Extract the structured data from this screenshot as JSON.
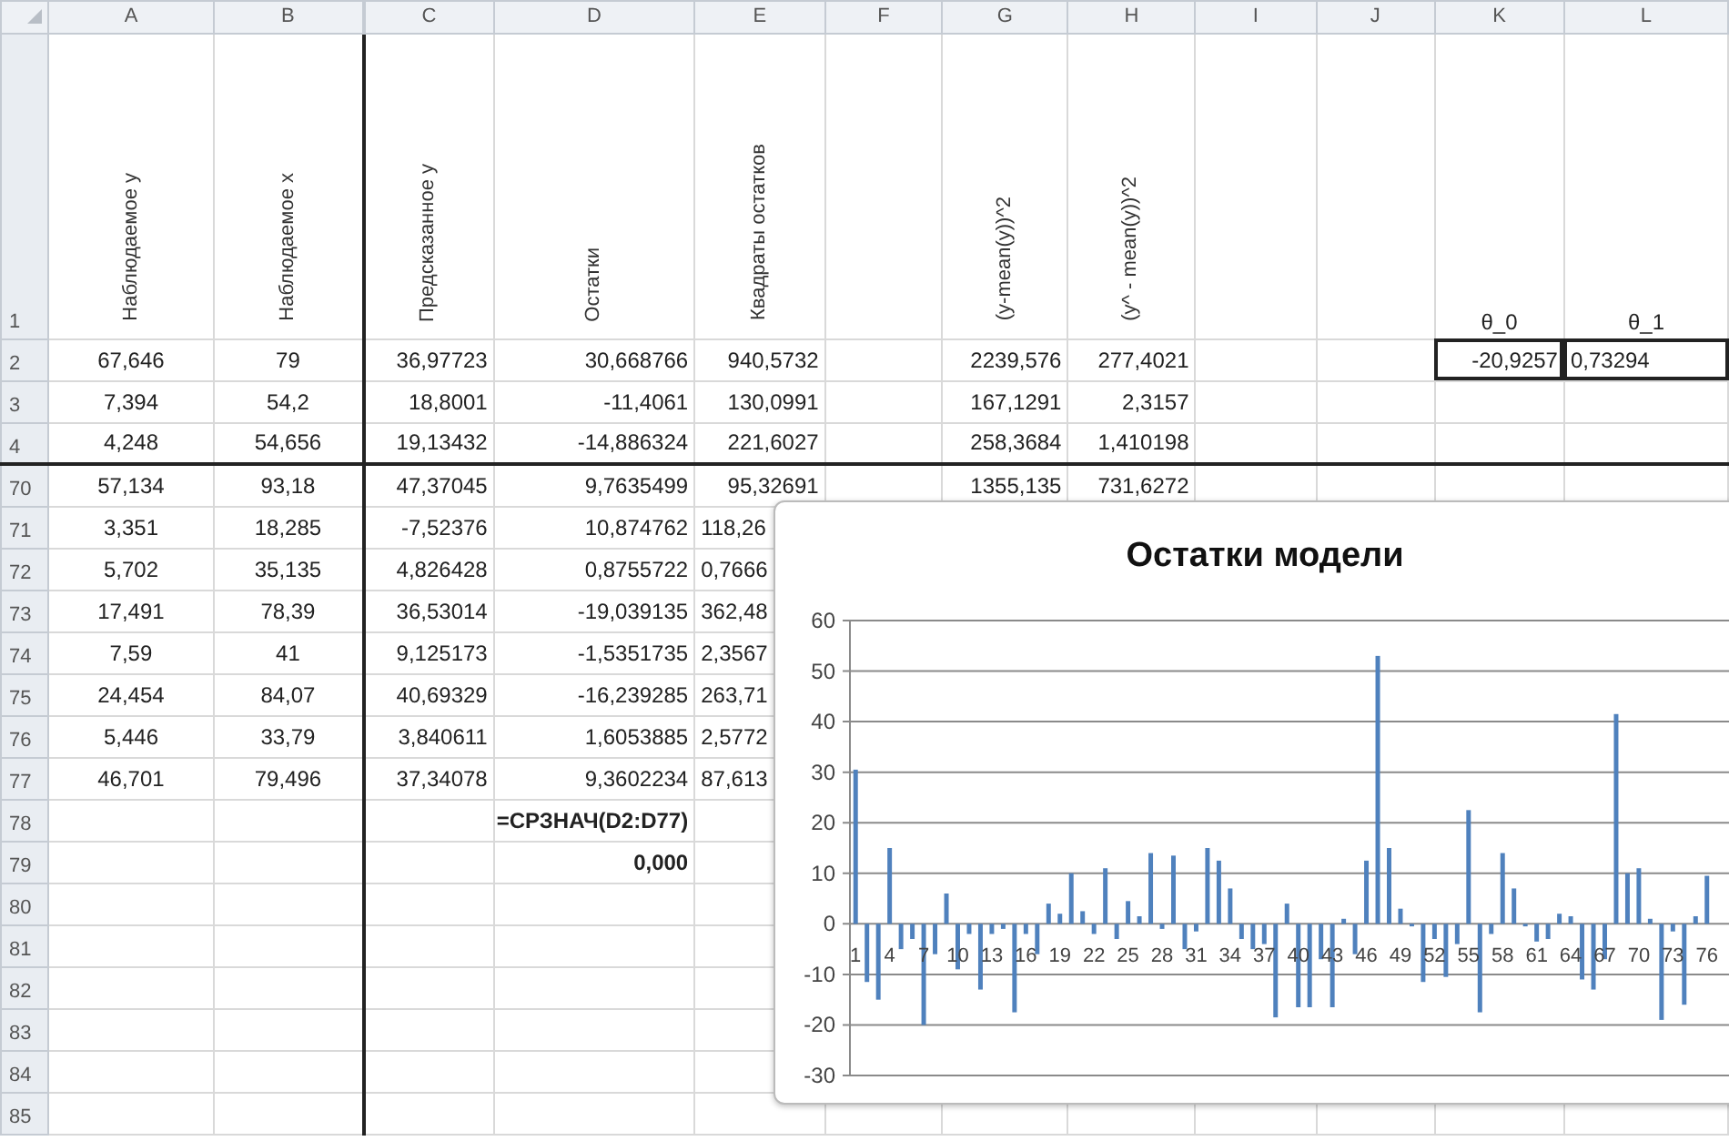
{
  "columns": [
    "A",
    "B",
    "C",
    "D",
    "E",
    "F",
    "G",
    "H",
    "I",
    "J",
    "K",
    "L"
  ],
  "rows": [
    {
      "number": "1",
      "cells": {
        "A": {
          "text": "Наблюдаемое y",
          "kind": "header",
          "outlined": false
        },
        "B": {
          "text": "Наблюдаемое x",
          "kind": "header",
          "outlined": false
        },
        "C": {
          "text": "Предсказанное y",
          "kind": "header",
          "outlined": false
        },
        "D": {
          "text": "Остатки",
          "kind": "header",
          "outlined": false
        },
        "E": {
          "text": "Квадраты остатков",
          "kind": "header",
          "outlined": false
        },
        "G": {
          "text": "(y-mean(y))^2",
          "kind": "header",
          "outlined": false
        },
        "H": {
          "text": "(y^ - mean(y))^2",
          "kind": "header",
          "outlined": false
        },
        "K": {
          "text": "θ_0",
          "kind": "label",
          "outlined": false
        },
        "L": {
          "text": "θ_1",
          "kind": "label",
          "outlined": false
        }
      }
    },
    {
      "number": "2",
      "cells": {
        "A": {
          "text": "67,646",
          "kind": "number",
          "outlined": false
        },
        "B": {
          "text": "79",
          "kind": "number",
          "outlined": false
        },
        "C": {
          "text": "36,97723",
          "kind": "number",
          "outlined": false
        },
        "D": {
          "text": "30,668766",
          "kind": "number",
          "outlined": false
        },
        "E": {
          "text": "940,5732",
          "kind": "number",
          "outlined": false
        },
        "G": {
          "text": "2239,576",
          "kind": "number",
          "outlined": false
        },
        "H": {
          "text": "277,4021",
          "kind": "number",
          "outlined": false
        },
        "K": {
          "text": "-20,9257",
          "kind": "number",
          "outlined": true
        },
        "L": {
          "text": "0,73294",
          "kind": "clipped",
          "outlined": true
        }
      }
    },
    {
      "number": "3",
      "cells": {
        "A": {
          "text": "7,394",
          "kind": "number",
          "outlined": false
        },
        "B": {
          "text": "54,2",
          "kind": "number",
          "outlined": false
        },
        "C": {
          "text": "18,8001",
          "kind": "number",
          "outlined": false
        },
        "D": {
          "text": "-11,4061",
          "kind": "number",
          "outlined": false
        },
        "E": {
          "text": "130,0991",
          "kind": "number",
          "outlined": false
        },
        "G": {
          "text": "167,1291",
          "kind": "number",
          "outlined": false
        },
        "H": {
          "text": "2,3157",
          "kind": "number",
          "outlined": false
        }
      }
    },
    {
      "number": "4",
      "cells": {
        "A": {
          "text": "4,248",
          "kind": "number",
          "outlined": false
        },
        "B": {
          "text": "54,656",
          "kind": "number",
          "outlined": false
        },
        "C": {
          "text": "19,13432",
          "kind": "number",
          "outlined": false
        },
        "D": {
          "text": "-14,886324",
          "kind": "number",
          "outlined": false
        },
        "E": {
          "text": "221,6027",
          "kind": "number",
          "outlined": false
        },
        "G": {
          "text": "258,3684",
          "kind": "number",
          "outlined": false
        },
        "H": {
          "text": "1,410198",
          "kind": "number",
          "outlined": false
        }
      }
    },
    {
      "number": "70",
      "cells": {
        "A": {
          "text": "57,134",
          "kind": "number",
          "outlined": false
        },
        "B": {
          "text": "93,18",
          "kind": "number",
          "outlined": false
        },
        "C": {
          "text": "47,37045",
          "kind": "number",
          "outlined": false
        },
        "D": {
          "text": "9,7635499",
          "kind": "number",
          "outlined": false
        },
        "E": {
          "text": "95,32691",
          "kind": "number",
          "outlined": false
        },
        "G": {
          "text": "1355,135",
          "kind": "number",
          "outlined": false
        },
        "H": {
          "text": "731,6272",
          "kind": "number",
          "outlined": false
        }
      }
    },
    {
      "number": "71",
      "cells": {
        "A": {
          "text": "3,351",
          "kind": "number",
          "outlined": false
        },
        "B": {
          "text": "18,285",
          "kind": "number",
          "outlined": false
        },
        "C": {
          "text": "-7,52376",
          "kind": "number",
          "outlined": false
        },
        "D": {
          "text": "10,874762",
          "kind": "number",
          "outlined": false
        },
        "E": {
          "text": "118,26",
          "kind": "clipped",
          "outlined": false
        }
      }
    },
    {
      "number": "72",
      "cells": {
        "A": {
          "text": "5,702",
          "kind": "number",
          "outlined": false
        },
        "B": {
          "text": "35,135",
          "kind": "number",
          "outlined": false
        },
        "C": {
          "text": "4,826428",
          "kind": "number",
          "outlined": false
        },
        "D": {
          "text": "0,8755722",
          "kind": "number",
          "outlined": false
        },
        "E": {
          "text": "0,7666",
          "kind": "clipped",
          "outlined": false
        }
      }
    },
    {
      "number": "73",
      "cells": {
        "A": {
          "text": "17,491",
          "kind": "number",
          "outlined": false
        },
        "B": {
          "text": "78,39",
          "kind": "number",
          "outlined": false
        },
        "C": {
          "text": "36,53014",
          "kind": "number",
          "outlined": false
        },
        "D": {
          "text": "-19,039135",
          "kind": "number",
          "outlined": false
        },
        "E": {
          "text": "362,48",
          "kind": "clipped",
          "outlined": false
        }
      }
    },
    {
      "number": "74",
      "cells": {
        "A": {
          "text": "7,59",
          "kind": "number",
          "outlined": false
        },
        "B": {
          "text": "41",
          "kind": "number",
          "outlined": false
        },
        "C": {
          "text": "9,125173",
          "kind": "number",
          "outlined": false
        },
        "D": {
          "text": "-1,5351735",
          "kind": "number",
          "outlined": false
        },
        "E": {
          "text": "2,3567",
          "kind": "clipped",
          "outlined": false
        }
      }
    },
    {
      "number": "75",
      "cells": {
        "A": {
          "text": "24,454",
          "kind": "number",
          "outlined": false
        },
        "B": {
          "text": "84,07",
          "kind": "number",
          "outlined": false
        },
        "C": {
          "text": "40,69329",
          "kind": "number",
          "outlined": false
        },
        "D": {
          "text": "-16,239285",
          "kind": "number",
          "outlined": false
        },
        "E": {
          "text": "263,71",
          "kind": "clipped",
          "outlined": false
        }
      }
    },
    {
      "number": "76",
      "cells": {
        "A": {
          "text": "5,446",
          "kind": "number",
          "outlined": false
        },
        "B": {
          "text": "33,79",
          "kind": "number",
          "outlined": false
        },
        "C": {
          "text": "3,840611",
          "kind": "number",
          "outlined": false
        },
        "D": {
          "text": "1,6053885",
          "kind": "number",
          "outlined": false
        },
        "E": {
          "text": "2,5772",
          "kind": "clipped",
          "outlined": false
        }
      }
    },
    {
      "number": "77",
      "cells": {
        "A": {
          "text": "46,701",
          "kind": "number",
          "outlined": false
        },
        "B": {
          "text": "79,496",
          "kind": "number",
          "outlined": false
        },
        "C": {
          "text": "37,34078",
          "kind": "number",
          "outlined": false
        },
        "D": {
          "text": "9,3602234",
          "kind": "number",
          "outlined": false
        },
        "E": {
          "text": "87,613",
          "kind": "clipped",
          "outlined": false
        }
      }
    },
    {
      "number": "78",
      "cells": {
        "D": {
          "text": "=СРЗНАЧ(D2:D77)",
          "kind": "formula",
          "outlined": false
        }
      }
    },
    {
      "number": "79",
      "cells": {
        "D": {
          "text": "0,000",
          "kind": "result",
          "outlined": false
        }
      }
    },
    {
      "number": "80"
    },
    {
      "number": "81"
    },
    {
      "number": "82"
    },
    {
      "number": "83"
    },
    {
      "number": "84"
    },
    {
      "number": "85"
    }
  ],
  "chart": {
    "chart_data": {
      "type": "bar",
      "title": "Остатки модели",
      "grid": true,
      "x": [
        1,
        2,
        3,
        4,
        5,
        6,
        7,
        8,
        9,
        10,
        11,
        12,
        13,
        14,
        15,
        16,
        17,
        18,
        19,
        20,
        21,
        22,
        23,
        24,
        25,
        26,
        27,
        28,
        29,
        30,
        31,
        32,
        33,
        34,
        35,
        36,
        37,
        38,
        39,
        40,
        41,
        42,
        43,
        44,
        45,
        46,
        47,
        48,
        49,
        50,
        51,
        52,
        53,
        54,
        55,
        56,
        57,
        58,
        59,
        60,
        61,
        62,
        63,
        64,
        65,
        66,
        67,
        68,
        69,
        70,
        71,
        72,
        73,
        74,
        75,
        76
      ],
      "xlim": [
        0.5,
        76.5
      ],
      "series": [
        {
          "color": "#4f81bd",
          "values": [
            30.5,
            -11.5,
            -15,
            15,
            -5,
            -3,
            -20,
            -6,
            6,
            -9,
            -2,
            -13,
            -2,
            -1,
            -17.5,
            -2,
            -6,
            4,
            2,
            10,
            2.5,
            -2,
            11,
            -3,
            4.5,
            1.5,
            14,
            -1,
            13.5,
            -5,
            -1.5,
            15,
            12.5,
            7,
            -3,
            -5,
            -4,
            -18.5,
            4,
            -16.5,
            -16.5,
            -7,
            -16.5,
            1,
            -6,
            12.5,
            53,
            15,
            3,
            -0.5,
            -11.5,
            -3,
            -10.5,
            -4,
            22.5,
            -17.5,
            -2,
            14,
            7,
            -0.5,
            -3.5,
            -3,
            2,
            1.5,
            -11,
            -13,
            -7,
            41.5,
            10,
            11,
            1,
            -19,
            -1.5,
            -16,
            1.5,
            9.5
          ]
        }
      ],
      "xticks": [
        {
          "value": 1,
          "label": "1"
        },
        {
          "value": 4,
          "label": "4"
        },
        {
          "value": 7,
          "label": "7"
        },
        {
          "value": 10,
          "label": "10"
        },
        {
          "value": 13,
          "label": "13"
        },
        {
          "value": 16,
          "label": "16"
        },
        {
          "value": 19,
          "label": "19"
        },
        {
          "value": 22,
          "label": "22"
        },
        {
          "value": 25,
          "label": "25"
        },
        {
          "value": 28,
          "label": "28"
        },
        {
          "value": 31,
          "label": "31"
        },
        {
          "value": 34,
          "label": "34"
        },
        {
          "value": 37,
          "label": "37"
        },
        {
          "value": 40,
          "label": "40"
        },
        {
          "value": 43,
          "label": "43"
        },
        {
          "value": 46,
          "label": "46"
        },
        {
          "value": 49,
          "label": "49"
        },
        {
          "value": 52,
          "label": "52"
        },
        {
          "value": 55,
          "label": "55"
        },
        {
          "value": 58,
          "label": "58"
        },
        {
          "value": 61,
          "label": "61"
        },
        {
          "value": 64,
          "label": "64"
        },
        {
          "value": 67,
          "label": "67"
        },
        {
          "value": 70,
          "label": "70"
        },
        {
          "value": 73,
          "label": "73"
        },
        {
          "value": 76,
          "label": "76"
        }
      ],
      "ylim": [
        -30,
        60
      ],
      "yticks": [
        -30,
        -20,
        -10,
        0,
        10,
        20,
        30,
        40,
        50,
        60
      ]
    }
  }
}
